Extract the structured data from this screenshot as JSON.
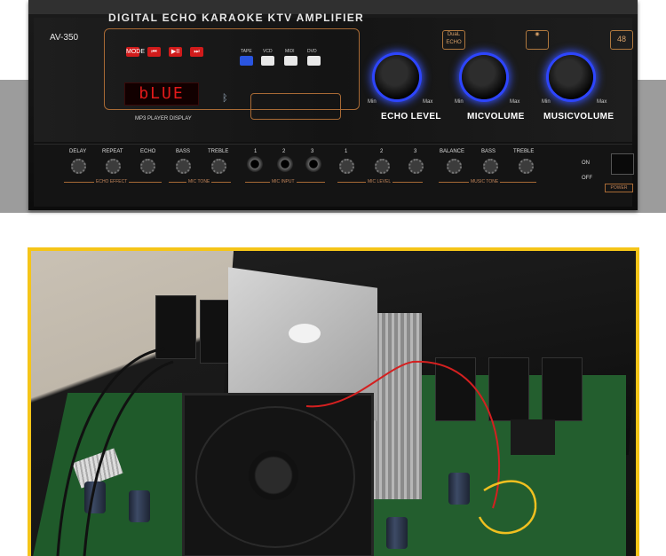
{
  "amplifier": {
    "title": "DIGITAL ECHO KARAOKE KTV AMPLIFIER",
    "model": "AV-350",
    "display_text": "bLUE",
    "mp3_label": "MP3 PLAYER DISPLAY",
    "player_buttons": [
      "MODE",
      "⏮",
      "▶II",
      "⏭"
    ],
    "source_buttons": [
      "TAPE",
      "VCD",
      "MIDI",
      "DVD"
    ],
    "badges": [
      "DuaL ECHO",
      "48"
    ],
    "knobs": [
      "ECHO LEVEL",
      "MICVOLUME",
      "MUSICVOLUME"
    ],
    "knob_min": "Min",
    "knob_max": "Max",
    "lower_labels": [
      "DELAY",
      "REPEAT",
      "ECHO",
      "BASS",
      "TREBLE",
      "1",
      "2",
      "3",
      "1",
      "2",
      "3",
      "BALANCE",
      "BASS",
      "TREBLE"
    ],
    "groups": [
      "ECHO EFFECT",
      "MIC TONE",
      "MIC INPUT",
      "MIC LEVEL",
      "MUSIC TONE"
    ],
    "on_label": "ON",
    "off_label": "OFF",
    "power_label": "POWER"
  },
  "colors": {
    "frame": "#f5c518",
    "led": "#e21a1a",
    "knob_glow": "#3a56ff",
    "accent": "#a86a35"
  }
}
